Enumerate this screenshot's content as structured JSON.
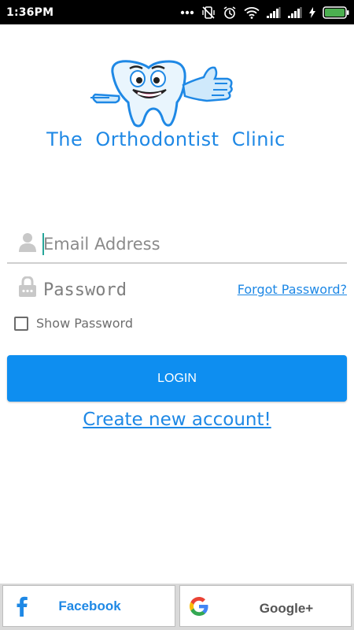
{
  "status_bar": {
    "time": "1:36PM",
    "icons": [
      "more-dots-icon",
      "vibrate-off-icon",
      "alarm-icon",
      "wifi-icon",
      "signal-1-icon",
      "signal-2-icon",
      "charging-icon",
      "battery-icon"
    ]
  },
  "app": {
    "clinic_name": "The Orthodontist Clinic",
    "logo_icon": "tooth-mascot-icon"
  },
  "login_form": {
    "email_placeholder": "Email Address",
    "password_placeholder": "Password",
    "forgot_password": "Forgot Password?",
    "show_password_label": "Show Password",
    "show_password_checked": false,
    "login_button": "LOGIN",
    "create_account": "Create new account!"
  },
  "social": {
    "facebook_label": "Facebook",
    "google_label": "Google+"
  },
  "colors": {
    "accent": "#1e88e5",
    "button": "#0e8ef0",
    "status_bar": "#000000"
  }
}
